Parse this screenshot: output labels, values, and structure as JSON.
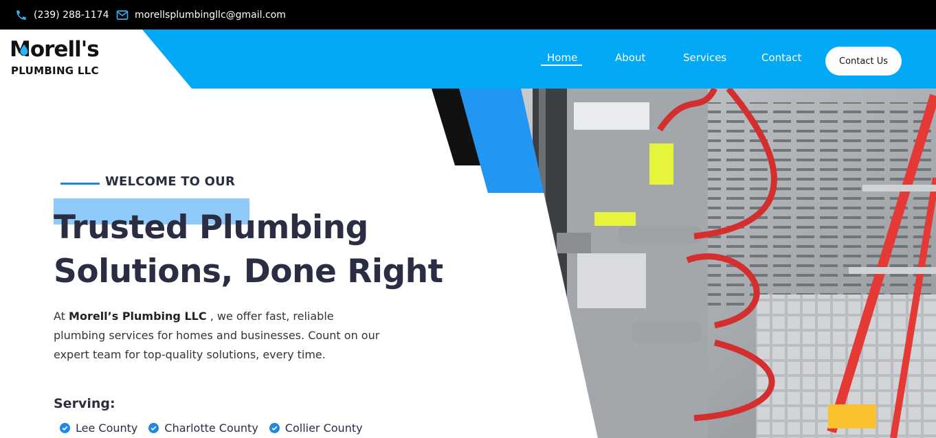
{
  "topbar": {
    "phone": "(239) 288-1174",
    "email": "morellsplumbingllc@gmail.com"
  },
  "logo": {
    "line1": "Morell's",
    "line2": "PLUMBING LLC"
  },
  "nav": {
    "items": [
      {
        "label": "Home",
        "active": true
      },
      {
        "label": "About"
      },
      {
        "label": "Services"
      },
      {
        "label": "Contact"
      }
    ],
    "cta_label": "Contact Us"
  },
  "hero": {
    "eyebrow": "WELCOME TO OUR",
    "headline_line1": "Trusted Plumbing",
    "headline_line2": "Solutions, Done Right",
    "intro_prefix": "At",
    "intro_company": "Morell’s Plumbing LLC",
    "intro_rest": ", we offer fast, reliable plumbing services for homes and businesses. Count on our expert team for top-quality solutions, every time.",
    "serving_label": "Serving:",
    "counties": [
      "Lee County",
      "Charlotte County",
      "Collier County"
    ]
  },
  "colors": {
    "brand_blue": "#03a9f4",
    "accent_blue": "#1e88e5",
    "highlight": "#90caf9",
    "dark_text": "#2b2d42",
    "topbar": "#000000"
  },
  "icons": {
    "phone": "phone-icon",
    "email": "mail-icon",
    "check": "check-circle-icon",
    "logo_drop": "water-drop-icon"
  }
}
